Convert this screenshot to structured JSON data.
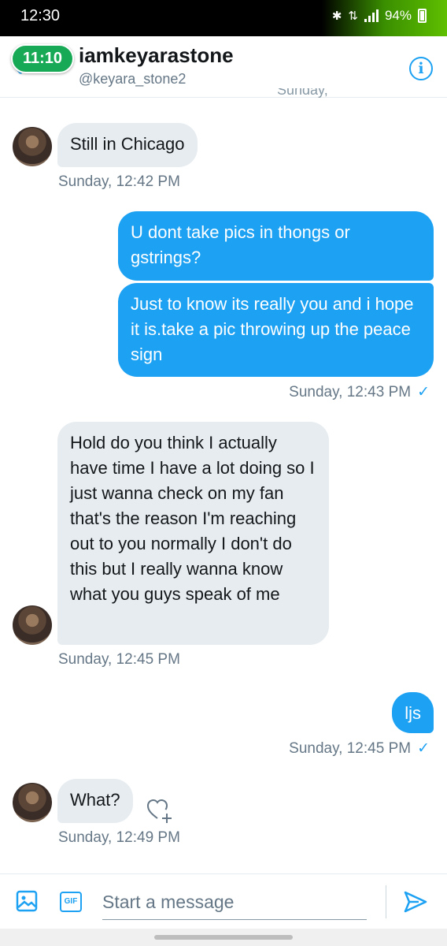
{
  "status_bar": {
    "time": "12:30",
    "battery": "94%",
    "battery_level": 0.94
  },
  "header": {
    "call_pill": "11:10",
    "name": "iamkeyarastone",
    "handle": "@keyara_stone2",
    "cut_timestamp": "Sunday,"
  },
  "messages": [
    {
      "dir": "in",
      "text": "Still in Chicago",
      "time": "Sunday, 12:42 PM"
    },
    {
      "dir": "out",
      "text": "U dont take pics in thongs or gstrings?"
    },
    {
      "dir": "out",
      "text": "Just to know its really you and i hope it is.take a pic throwing up the peace sign",
      "time": "Sunday, 12:43 PM"
    },
    {
      "dir": "in",
      "text": "Hold do you think I actually have time I have a lot doing so I just wanna check on my fan that's the reason I'm reaching out to you normally I don't do this but I really wanna know what you guys speak of me",
      "time": "Sunday, 12:45 PM"
    },
    {
      "dir": "out",
      "text": "ljs",
      "time": "Sunday, 12:45 PM"
    },
    {
      "dir": "in",
      "text": "What?",
      "time": "Sunday, 12:49 PM"
    }
  ],
  "composer": {
    "placeholder": "Start a message",
    "gif_label": "GIF"
  },
  "colors": {
    "accent": "#1da1f2",
    "incoming_bubble": "#e6ecf0",
    "call_pill": "#18a957"
  }
}
